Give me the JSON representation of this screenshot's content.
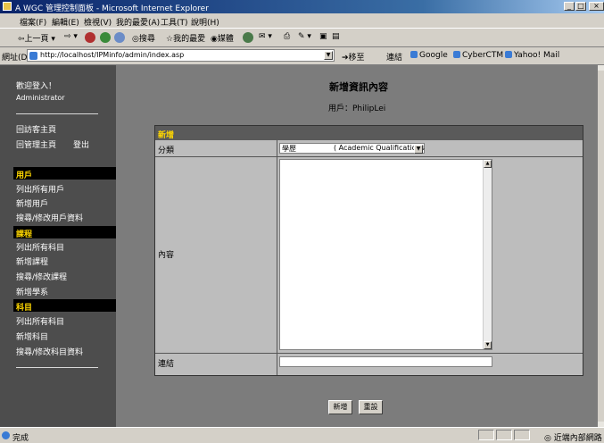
{
  "window": {
    "title": "A WGC 管理控制面板 - Microsoft Internet Explorer",
    "controls": [
      "_",
      "□",
      "×"
    ]
  },
  "menu": [
    "檔案(F)",
    "編輯(E)",
    "檢視(V)",
    "我的最愛(A)",
    "工具(T)",
    "說明(H)"
  ],
  "toolbar": {
    "back": "上一頁",
    "search": "搜尋",
    "favorites": "我的最愛",
    "media": "媒體"
  },
  "address": {
    "label": "網址(D)",
    "url": "http://localhost/IPMinfo/admin/index.asp",
    "go": "移至",
    "links_label": "連結",
    "links": [
      "Google",
      "CyberCTM",
      "Yahoo! Mail"
    ]
  },
  "sidebar": {
    "welcome": "歡迎登入！",
    "user": "Administrator",
    "nav_home": "回訪客主頁",
    "nav_admin": "回管理主頁",
    "logout": "登出",
    "sections": [
      {
        "title": "用戶",
        "items": [
          "列出所有用戶",
          "新增用戶",
          "搜尋/修改用戶資料"
        ]
      },
      {
        "title": "課程",
        "items": [
          "列出所有科目",
          "新增課程",
          "搜尋/修改課程",
          "新增學系"
        ]
      },
      {
        "title": "科目",
        "items": [
          "列出所有科目",
          "新增科目",
          "搜尋/修改科目資料"
        ]
      }
    ]
  },
  "main": {
    "title": "新增資訊內容",
    "user_line": "用戶：PhilipLei"
  },
  "form": {
    "header": "新增",
    "category_label": "分類",
    "category_value": "學歷",
    "category_value_en": "( Academic Qualifications",
    "content_label": "內容",
    "link_label": "連結",
    "link_value": "",
    "submit": "新增",
    "reset": "重設"
  },
  "status": {
    "text": "完成",
    "zone": "近端內部網路"
  }
}
